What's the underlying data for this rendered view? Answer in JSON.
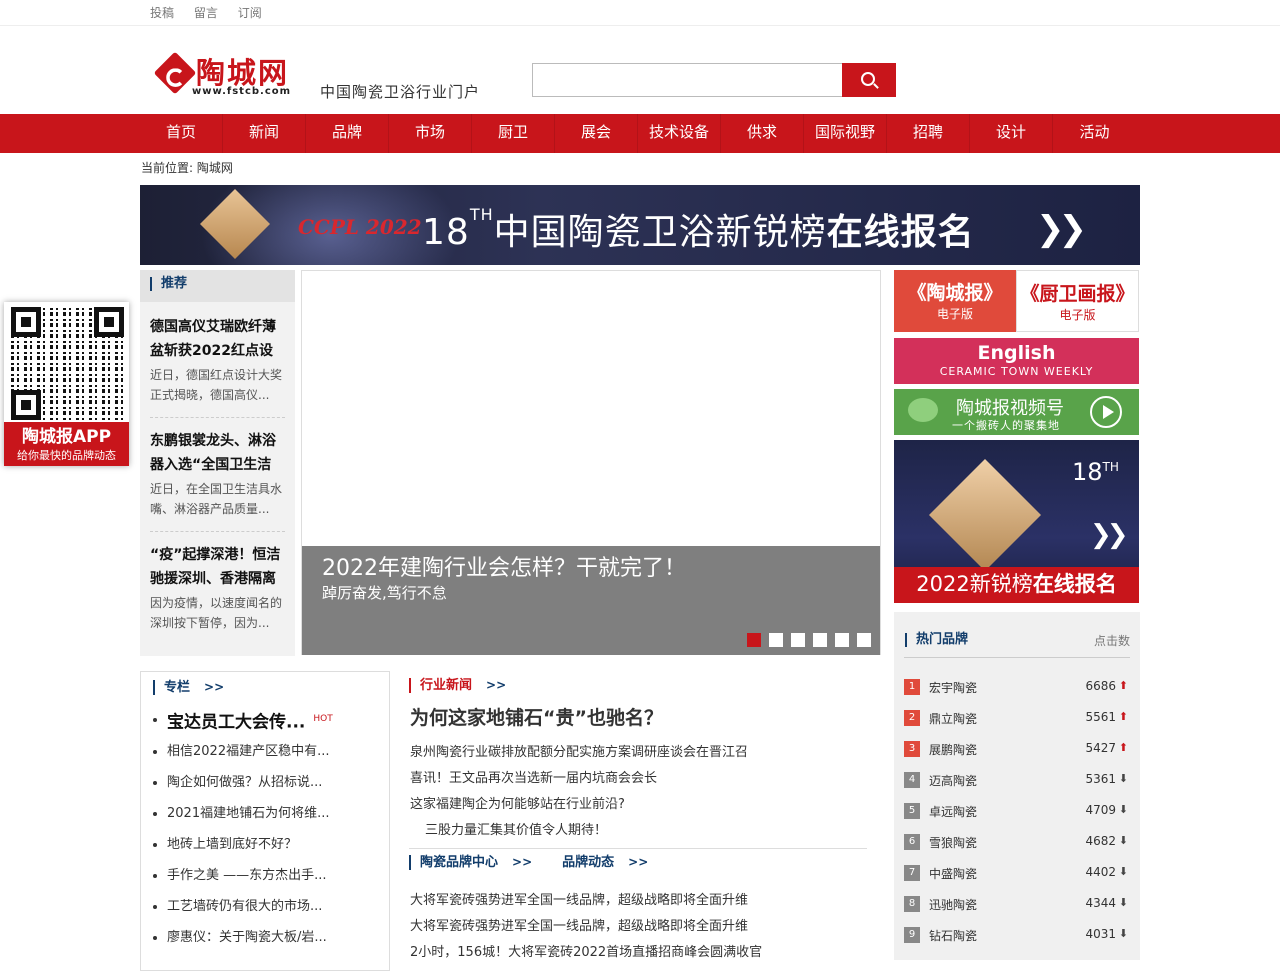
{
  "topbar": {
    "links": [
      "投稿",
      "留言",
      "订阅"
    ]
  },
  "header": {
    "logo_name": "陶城网",
    "logo_url": "www.fstcb.com",
    "slogan": "中国陶瓷卫浴行业门户",
    "search_placeholder": ""
  },
  "nav": {
    "items": [
      "首页",
      "新闻",
      "品牌",
      "市场",
      "厨卫",
      "展会",
      "技术设备",
      "供求",
      "国际视野",
      "招聘",
      "设计",
      "活动"
    ]
  },
  "breadcrumb": "当前位置: 陶城网",
  "banner": {
    "year": "CCPL 2022",
    "text_pre": "18",
    "text_sup": "TH",
    "text_main": "中国陶瓷卫浴新锐榜",
    "text_bold": "在线报名",
    "arrows": "❯❯"
  },
  "recommend": {
    "title": "推荐",
    "items": [
      {
        "title": "德国高仪艾瑞欧纤薄盆斩获2022红点设",
        "desc": "近日，德国红点设计大奖正式揭晓，德国高仪..."
      },
      {
        "title": "东鹏银裳龙头、淋浴器入选“全国卫生洁",
        "desc": "近日，在全国卫生洁具水嘴、淋浴器产品质量..."
      },
      {
        "title": "“疫”起撑深港！恒洁驰援深圳、香港隔离",
        "desc": "因为疫情，以速度闻名的深圳按下暂停，因为..."
      }
    ]
  },
  "app_qr": {
    "title": "陶城报APP",
    "subtitle": "给你最快的品牌动态"
  },
  "slider": {
    "caption": "2022年建陶行业会怎样？干就完了！",
    "subcaption": "踔厉奋发,笃行不怠",
    "dot_count": 6,
    "active_dot": 0
  },
  "epaper": {
    "left_big": "《陶城报》",
    "left_small": "电子版",
    "right_big": "《厨卫画报》",
    "right_small": "电子版"
  },
  "english": {
    "title": "English",
    "subtitle": "CERAMIC TOWN WEEKLY"
  },
  "video": {
    "title": "陶城报视频号",
    "subtitle": "一个搬砖人的聚集地"
  },
  "ad2": {
    "th_num": "18",
    "th_sup": "TH",
    "arrows": "❯❯",
    "footer_pre": "2022新锐榜",
    "footer_bold": "在线报名"
  },
  "hot_brands": {
    "title": "热门品牌",
    "clicks_label": "点击数",
    "items": [
      {
        "rank": "1",
        "name": "宏宇陶瓷",
        "count": "6686",
        "trend": "up"
      },
      {
        "rank": "2",
        "name": "鼎立陶瓷",
        "count": "5561",
        "trend": "up"
      },
      {
        "rank": "3",
        "name": "展鹏陶瓷",
        "count": "5427",
        "trend": "up"
      },
      {
        "rank": "4",
        "name": "迈高陶瓷",
        "count": "5361",
        "trend": "down"
      },
      {
        "rank": "5",
        "name": "卓远陶瓷",
        "count": "4709",
        "trend": "down"
      },
      {
        "rank": "6",
        "name": "雪狼陶瓷",
        "count": "4682",
        "trend": "down"
      },
      {
        "rank": "7",
        "name": "中盛陶瓷",
        "count": "4402",
        "trend": "down"
      },
      {
        "rank": "8",
        "name": "迅驰陶瓷",
        "count": "4344",
        "trend": "down"
      },
      {
        "rank": "9",
        "name": "钻石陶瓷",
        "count": "4031",
        "trend": "down"
      }
    ]
  },
  "column": {
    "title": "专栏",
    "more": ">>",
    "hot_tag": "HOT",
    "items": [
      "宝达员工大会传...",
      "相信2022福建产区稳中有...",
      "陶企如何做强？从招标说...",
      "2021福建地铺石为何将维...",
      "地砖上墙到底好不好？",
      "手作之美 ——东方杰出手...",
      "工艺墙砖仍有很大的市场...",
      "廖惠仪：关于陶瓷大板/岩..."
    ]
  },
  "industry_news": {
    "title": "行业新闻",
    "more": ">>",
    "headline": "为何这家地铺石“贵”也驰名？",
    "items": [
      "泉州陶瓷行业碳排放配额分配实施方案调研座谈会在晋江召",
      "喜讯！王文品再次当选新一届内坑商会会长",
      "这家福建陶企为何能够站在行业前沿?",
      "三股力量汇集其价值令人期待！"
    ]
  },
  "brand_center": {
    "title": "陶瓷品牌中心",
    "more": ">>",
    "title2": "品牌动态",
    "more2": ">>",
    "items": [
      "大将军瓷砖强势进军全国一线品牌，超级战略即将全面升维",
      "大将军瓷砖强势进军全国一线品牌，超级战略即将全面升维",
      "2小时，156城！大将军瓷砖2022首场直播招商峰会圆满收官"
    ]
  }
}
